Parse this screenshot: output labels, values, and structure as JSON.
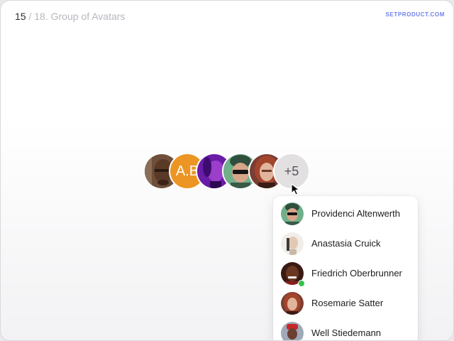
{
  "header": {
    "page_number": "15",
    "separator": " / ",
    "title": "18. Group of Avatars",
    "brand": "SETPRODUCT.COM"
  },
  "avatar_group": {
    "initials": "A.B",
    "more_label": "+5"
  },
  "dropdown": {
    "items": [
      {
        "name": "Providenci Altenwerth",
        "online": false
      },
      {
        "name": "Anastasia Cruick",
        "online": false
      },
      {
        "name": "Friedrich Oberbrunner",
        "online": true
      },
      {
        "name": "Rosemarie Satter",
        "online": false
      },
      {
        "name": "Well Stiedemann",
        "online": true
      }
    ]
  },
  "colors": {
    "initials_bg": "#ec9524",
    "more_bg": "#e2e0e0",
    "online": "#35c14a",
    "brand": "#6d7fe8"
  }
}
